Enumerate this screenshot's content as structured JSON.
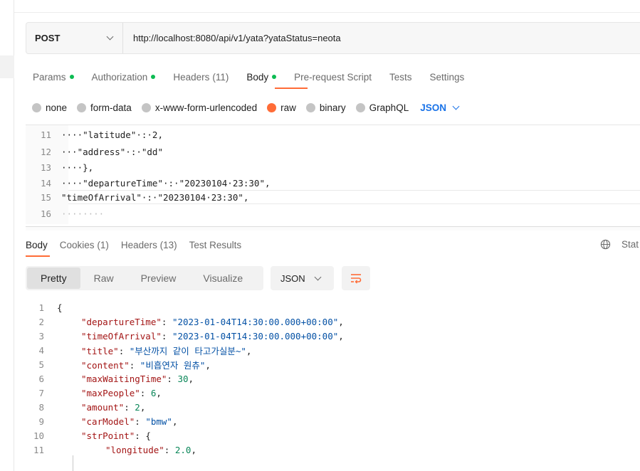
{
  "request": {
    "method": "POST",
    "url": "http://localhost:8080/api/v1/yata?yataStatus=neota"
  },
  "request_tabs": [
    {
      "label": "Params",
      "dot": true
    },
    {
      "label": "Authorization",
      "dot": true
    },
    {
      "label": "Headers",
      "count": "(11)"
    },
    {
      "label": "Body",
      "dot": true
    },
    {
      "label": "Pre-request Script"
    },
    {
      "label": "Tests"
    },
    {
      "label": "Settings"
    }
  ],
  "body_types": [
    "none",
    "form-data",
    "x-www-form-urlencoded",
    "raw",
    "binary",
    "GraphQL"
  ],
  "body_format": "JSON",
  "editor_lines": [
    {
      "n": "11",
      "text": "····\"latitude\"·:·2,"
    },
    {
      "n": "12",
      "text": "···\"address\"·:·\"dd\""
    },
    {
      "n": "13",
      "text": "····},"
    },
    {
      "n": "14",
      "text": "····\"departureTime\"·:·\"20230104·23:30\","
    },
    {
      "n": "15",
      "text": "\"timeOfArrival\"·:·\"20230104·23:30\","
    },
    {
      "n": "16",
      "text": "········"
    }
  ],
  "response_tabs": [
    {
      "label": "Body"
    },
    {
      "label": "Cookies",
      "count": "(1)"
    },
    {
      "label": "Headers",
      "count": "(13)"
    },
    {
      "label": "Test Results"
    }
  ],
  "status_label": "Stat",
  "view_modes": [
    "Pretty",
    "Raw",
    "Preview",
    "Visualize"
  ],
  "response_format": "JSON",
  "response_lines": [
    {
      "n": "1",
      "indent": 0,
      "punct": "{"
    },
    {
      "n": "2",
      "indent": 1,
      "key": "\"departureTime\"",
      "sep": ": ",
      "str": "\"2023-01-04T14:30:00.000+00:00\"",
      "end": ","
    },
    {
      "n": "3",
      "indent": 1,
      "key": "\"timeOfArrival\"",
      "sep": ": ",
      "str": "\"2023-01-04T14:30:00.000+00:00\"",
      "end": ","
    },
    {
      "n": "4",
      "indent": 1,
      "key": "\"title\"",
      "sep": ": ",
      "str": "\"부산까지 같이 타고가실분~\"",
      "end": ","
    },
    {
      "n": "5",
      "indent": 1,
      "key": "\"content\"",
      "sep": ": ",
      "str": "\"비흡연자 원츄\"",
      "end": ","
    },
    {
      "n": "6",
      "indent": 1,
      "key": "\"maxWaitingTime\"",
      "sep": ": ",
      "num": "30",
      "end": ","
    },
    {
      "n": "7",
      "indent": 1,
      "key": "\"maxPeople\"",
      "sep": ": ",
      "num": "6",
      "end": ","
    },
    {
      "n": "8",
      "indent": 1,
      "key": "\"amount\"",
      "sep": ": ",
      "num": "2",
      "end": ","
    },
    {
      "n": "9",
      "indent": 1,
      "key": "\"carModel\"",
      "sep": ": ",
      "str": "\"bmw\"",
      "end": ","
    },
    {
      "n": "10",
      "indent": 1,
      "key": "\"strPoint\"",
      "sep": ": ",
      "punct": "{"
    },
    {
      "n": "11",
      "indent": 2,
      "key": "\"longitude\"",
      "sep": ": ",
      "num": "2.0",
      "end": ","
    }
  ],
  "colors": {
    "accent": "#ff6c37",
    "dot_green": "#0cbb52",
    "json_blue": "#1a73e8"
  }
}
